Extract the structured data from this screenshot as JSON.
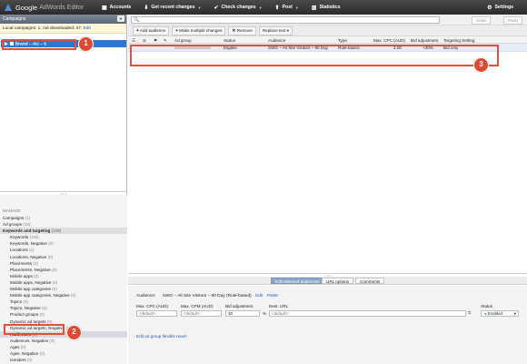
{
  "app": {
    "brand": "Google",
    "product": "AdWords Editor"
  },
  "toolbar": {
    "accounts": "Accounts",
    "get_recent": "Get recent changes",
    "check_changes": "Check changes",
    "post": "Post",
    "statistics": "Statistics",
    "settings": "Settings"
  },
  "left_panel": {
    "header": "Campaigns",
    "local_notice": "Local campaigns: 1, not downloaded: 47.",
    "edit_link": "Edit",
    "selected_campaign": "Brand – AU – S",
    "manage_title": "MANAGE",
    "manage_items": [
      {
        "label": "Campaigns",
        "count": "(1)"
      },
      {
        "label": "Ad groups",
        "count": "(38)"
      },
      {
        "label": "Keywords and targeting",
        "count": "(118)"
      },
      {
        "label": "Keywords",
        "count": "(115)"
      },
      {
        "label": "Keywords, Negative",
        "count": "(0)"
      },
      {
        "label": "Locations",
        "count": "(1)"
      },
      {
        "label": "Locations, Negative",
        "count": "(0)"
      },
      {
        "label": "Placements",
        "count": "(0)"
      },
      {
        "label": "Placements, Negative",
        "count": "(0)"
      },
      {
        "label": "Mobile apps",
        "count": "(0)"
      },
      {
        "label": "Mobile apps, Negative",
        "count": "(0)"
      },
      {
        "label": "Mobile app categories",
        "count": "(0)"
      },
      {
        "label": "Mobile app categories, Negative",
        "count": "(0)"
      },
      {
        "label": "Topics",
        "count": "(0)"
      },
      {
        "label": "Topics, Negative",
        "count": "(0)"
      },
      {
        "label": "Product groups",
        "count": "(0)"
      },
      {
        "label": "Dynamic ad targets",
        "count": "(0)"
      },
      {
        "label": "Dynamic ad targets, Negative",
        "count": "(0)"
      },
      {
        "label": "Audiences",
        "count": "(1)"
      },
      {
        "label": "Audiences, Negative",
        "count": "(0)"
      },
      {
        "label": "Ages",
        "count": "(0)"
      },
      {
        "label": "Ages, Negative",
        "count": "(0)"
      },
      {
        "label": "Genders",
        "count": "(0)"
      }
    ]
  },
  "main": {
    "search_placeholder": "",
    "undo": "Undo",
    "redo": "Redo",
    "actions": [
      "Add audience",
      "Make multiple changes",
      "Remove",
      "Replace text"
    ],
    "columns": [
      "Ad group",
      "Status",
      "Audience",
      "Type",
      "Max. CPC (AUD)",
      "Bid adjustment",
      "Targeting Setting"
    ],
    "row": {
      "status": "Eligible",
      "audience": "SWG – All Site Visitors – 90 Day",
      "type": "Rule-based",
      "max_cpc": "2.00",
      "bid_adjustment": "+30%",
      "targeting": "Bid only"
    }
  },
  "bottom": {
    "tabs": [
      "Edit selected audiences",
      "URL options",
      "Comments"
    ],
    "audience_label": "Audience:",
    "audience_value": "SWG – All Site Visitors – 90 Day (Rule-based)",
    "edit_link": "Edit",
    "paste_link": "Paste",
    "fields": {
      "max_cpc_label": "Max. CPC (AUD)",
      "max_cpm_label": "Max. CPM (AUD)",
      "bid_adj_label": "Bid adjustment",
      "dest_url_label": "Dest. URL",
      "status_label": "Status",
      "max_cpc_value": "<default>",
      "max_cpm_value": "<default>",
      "bid_adj_value": "30",
      "percent": "%",
      "dest_url_value": "<default>",
      "status_value": "Enabled"
    },
    "flex_reach_link": "Edit ad group flexible reach"
  },
  "callouts": [
    "1",
    "2",
    "3"
  ],
  "colors": {
    "callout": "#e0513a",
    "selection": "#2a77d4"
  }
}
